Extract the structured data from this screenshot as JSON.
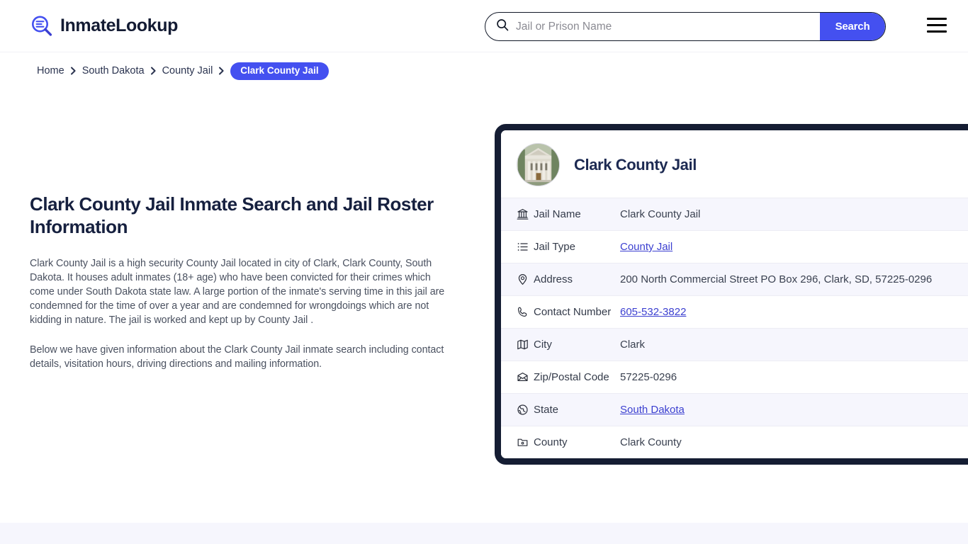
{
  "header": {
    "brand_name": "InmateLookup",
    "brand_icon": "magnifier-list-icon",
    "menu_icon": "hamburger-menu-icon"
  },
  "search": {
    "icon": "search-icon",
    "placeholder": "Jail or Prison Name",
    "value": "",
    "button_label": "Search"
  },
  "breadcrumb": {
    "items": [
      {
        "label": "Home",
        "current": false
      },
      {
        "label": "South Dakota",
        "current": false
      },
      {
        "label": "County Jail",
        "current": false
      },
      {
        "label": "Clark County Jail",
        "current": true
      }
    ]
  },
  "main": {
    "title": "Clark County Jail Inmate Search and Jail Roster Information",
    "paragraphs": [
      "Clark County Jail is a high security County Jail located in city of Clark, Clark County, South Dakota. It houses adult inmates (18+ age) who have been convicted for their crimes which come under South Dakota state law. A large portion of the inmate's serving time in this jail are condemned for the time of over a year and are condemned for wrongdoings which are not kidding in nature. The jail is worked and kept up by County Jail .",
      "Below we have given information about the Clark County Jail inmate search including contact details, visitation hours, driving directions and mailing information."
    ]
  },
  "card": {
    "photo_alt": "clark-county-courthouse-photo",
    "title": "Clark County Jail",
    "rows": [
      {
        "icon": "bank-icon",
        "label": "Jail Name",
        "value": "Clark County Jail",
        "link": false
      },
      {
        "icon": "list-icon",
        "label": "Jail Type",
        "value": "County Jail",
        "link": true
      },
      {
        "icon": "location-icon",
        "label": "Address",
        "value": "200 North Commercial Street PO Box 296, Clark, SD, 57225-0296",
        "link": false
      },
      {
        "icon": "phone-icon",
        "label": "Contact Number",
        "value": "605-532-3822",
        "link": true
      },
      {
        "icon": "map-icon",
        "label": "City",
        "value": "Clark",
        "link": false
      },
      {
        "icon": "envelope-icon",
        "label": "Zip/Postal Code",
        "value": "57225-0296",
        "link": false
      },
      {
        "icon": "globe-icon",
        "label": "State",
        "value": "South Dakota",
        "link": true
      },
      {
        "icon": "flag-icon",
        "label": "County",
        "value": "Clark County",
        "link": false
      }
    ]
  },
  "colors": {
    "accent": "#4450f0",
    "card_border": "#151d33",
    "row_alt": "#f6f6fd",
    "link": "#3b3fd0",
    "heading": "#16203f"
  }
}
